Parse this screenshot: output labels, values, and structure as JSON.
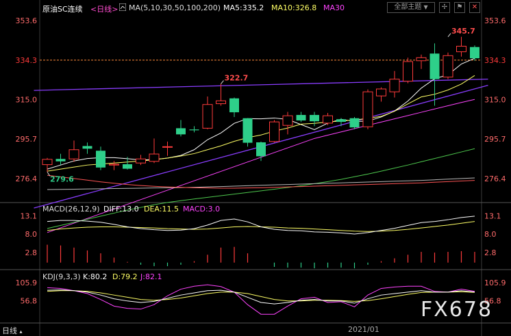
{
  "header": {
    "title": "原油SC连续",
    "period": "<日线>",
    "ma_label": "MA(5,10,30,50,100,200)",
    "ma5": "MA5:335.2",
    "ma10": "MA10:326.8",
    "ma30": "MA30",
    "all_themes": "全部主题",
    "indicator_icon": "bar-chart-icon"
  },
  "macd_header": {
    "label": "MACD(26,12,9)",
    "diff": "DIFF:13.0",
    "dea": "DEA:11.5",
    "macd": "MACD:3.0"
  },
  "kdj_header": {
    "label": "KDJ(9,3,3)",
    "k": "K:80.2",
    "d": "D:79.2",
    "j": "J:82.1"
  },
  "bottom": {
    "period": "日线",
    "date": "2021/01",
    "watermark": "FX678"
  },
  "colors": {
    "up": "#ff3b3b",
    "down": "#2ecf8a",
    "ma5": "#ffffff",
    "ma10": "#ffff66",
    "ma30": "#ff44ff",
    "ma50": "#4ec94e",
    "ma100": "#bbbbbb",
    "ma200": "#ff5555",
    "trend": "#8a3dff"
  },
  "chart_data": [
    {
      "type": "candlestick",
      "title": "原油SC连续 <日线>",
      "y_ticks": [
        "353.6",
        "334.3",
        "315.0",
        "295.7",
        "276.4"
      ],
      "ylim": [
        266.0,
        357.0
      ],
      "current_price": 334.3,
      "annotations": [
        {
          "label": "345.7",
          "value": 345.7,
          "index": 30
        },
        {
          "label": "322.7",
          "value": 322.7,
          "index": 13
        },
        {
          "label": "279.6",
          "value": 279.6,
          "index": 0
        }
      ],
      "candles": [
        {
          "o": 283.2,
          "c": 285.8,
          "h": 286.5,
          "l": 279.6
        },
        {
          "o": 286.0,
          "c": 284.8,
          "h": 288.5,
          "l": 283.0
        },
        {
          "o": 286.0,
          "c": 290.5,
          "h": 295.0,
          "l": 284.6
        },
        {
          "o": 292.3,
          "c": 291.0,
          "h": 294.0,
          "l": 288.5
        },
        {
          "o": 290.0,
          "c": 281.8,
          "h": 292.0,
          "l": 280.5
        },
        {
          "o": 283.0,
          "c": 283.4,
          "h": 285.0,
          "l": 280.5
        },
        {
          "o": 283.4,
          "c": 281.2,
          "h": 287.0,
          "l": 280.8
        },
        {
          "o": 284.0,
          "c": 286.0,
          "h": 288.0,
          "l": 283.0
        },
        {
          "o": 284.8,
          "c": 288.4,
          "h": 296.0,
          "l": 284.0
        },
        {
          "o": 292.0,
          "c": 292.0,
          "h": 294.5,
          "l": 287.5
        },
        {
          "o": 301.0,
          "c": 298.0,
          "h": 305.0,
          "l": 297.0
        },
        {
          "o": 300.4,
          "c": 300.0,
          "h": 302.0,
          "l": 299.0
        },
        {
          "o": 301.0,
          "c": 312.6,
          "h": 316.5,
          "l": 300.5
        },
        {
          "o": 313.0,
          "c": 314.4,
          "h": 322.7,
          "l": 312.0
        },
        {
          "o": 315.6,
          "c": 308.8,
          "h": 316.0,
          "l": 306.5
        },
        {
          "o": 305.9,
          "c": 293.9,
          "h": 306.0,
          "l": 292.0
        },
        {
          "o": 294.1,
          "c": 287.3,
          "h": 294.5,
          "l": 285.0
        },
        {
          "o": 294.5,
          "c": 304.1,
          "h": 305.0,
          "l": 294.0
        },
        {
          "o": 302.4,
          "c": 307.1,
          "h": 309.0,
          "l": 298.0
        },
        {
          "o": 307.5,
          "c": 304.8,
          "h": 309.0,
          "l": 304.0
        },
        {
          "o": 307.5,
          "c": 304.4,
          "h": 309.0,
          "l": 302.0
        },
        {
          "o": 303.5,
          "c": 307.1,
          "h": 308.5,
          "l": 302.5
        },
        {
          "o": 305.4,
          "c": 304.1,
          "h": 306.0,
          "l": 302.0
        },
        {
          "o": 305.9,
          "c": 301.4,
          "h": 306.5,
          "l": 300.5
        },
        {
          "o": 301.7,
          "c": 318.8,
          "h": 320.0,
          "l": 300.5
        },
        {
          "o": 316.8,
          "c": 320.2,
          "h": 321.0,
          "l": 314.0
        },
        {
          "o": 318.8,
          "c": 325.0,
          "h": 329.0,
          "l": 316.0
        },
        {
          "o": 324.0,
          "c": 333.6,
          "h": 335.5,
          "l": 323.0
        },
        {
          "o": 334.0,
          "c": 335.5,
          "h": 337.0,
          "l": 330.0
        },
        {
          "o": 337.5,
          "c": 325.0,
          "h": 342.5,
          "l": 312.0
        },
        {
          "o": 326.0,
          "c": 336.5,
          "h": 338.0,
          "l": 325.0
        },
        {
          "o": 338.4,
          "c": 341.1,
          "h": 345.7,
          "l": 336.0
        },
        {
          "o": 340.7,
          "c": 335.2,
          "h": 341.5,
          "l": 334.0
        }
      ],
      "ma": [
        {
          "name": "MA5",
          "values": [
            281,
            283,
            285,
            286.2,
            286.6,
            286.6,
            286.1,
            285.5,
            285.7,
            286.4,
            287.7,
            290.5,
            295.4,
            298.7,
            303.4,
            305.7,
            305.6,
            306.0,
            305.3,
            302.8,
            300.3,
            303.5,
            305.4,
            304.3,
            304.5,
            306.5,
            309.4,
            314.3,
            320.6,
            325.2,
            327.1,
            332.4,
            335.2
          ]
        },
        {
          "name": "MA10",
          "values": [
            280,
            281,
            282,
            283,
            283.5,
            284,
            284.5,
            285,
            285.6,
            286.4,
            287.4,
            288.6,
            290.5,
            292.4,
            294.6,
            296.4,
            297.7,
            299.6,
            301.1,
            303.0,
            303.4,
            304.0,
            304.6,
            305.0,
            305.8,
            306.8,
            309.3,
            312.9,
            316.3,
            317.6,
            319.7,
            322.6,
            326.8
          ]
        },
        {
          "name": "MA30",
          "values": [
            250,
            252.3,
            254.6,
            256.9,
            259.2,
            261.5,
            263.8,
            266.1,
            268.4,
            270.7,
            273,
            275.3,
            277.6,
            279.9,
            282.2,
            284.5,
            286.8,
            289.1,
            291.4,
            293.7,
            296,
            297.6,
            299.2,
            300.8,
            302.4,
            304,
            305.6,
            307.2,
            308.8,
            310.4,
            312,
            313.6,
            315.1
          ]
        },
        {
          "name": "MA50",
          "values": [
            252,
            253.5,
            255,
            256.5,
            258,
            259.5,
            261,
            262.3,
            263.6,
            264.7,
            265.6,
            266.4,
            267.2,
            268,
            268.8,
            269.6,
            270.4,
            271.2,
            272,
            272.9,
            273.9,
            274.9,
            276,
            277.3,
            278.6,
            280,
            281.5,
            283,
            284.6,
            286.2,
            287.8,
            289.4,
            291
          ]
        },
        {
          "name": "MA100",
          "values": [
            271,
            271.1,
            271.2,
            271.3,
            271.4,
            271.5,
            271.6,
            271.7,
            271.8,
            271.9,
            272,
            272.1,
            272.3,
            272.5,
            272.7,
            272.9,
            273.1,
            273.3,
            273.5,
            273.7,
            273.9,
            274.1,
            274.3,
            274.5,
            274.7,
            274.9,
            275.1,
            275.3,
            275.5,
            275.8,
            276.1,
            276.4,
            276.7
          ]
        },
        {
          "name": "MA200",
          "values": [
            278,
            277.2,
            276.4,
            275.6,
            274.8,
            274.1,
            273.5,
            273,
            272.6,
            272.3,
            272.1,
            271.9,
            271.8,
            271.7,
            271.7,
            271.8,
            271.9,
            272.1,
            272.3,
            272.5,
            272.7,
            272.9,
            273.1,
            273.3,
            273.5,
            273.7,
            273.9,
            274.1,
            274.3,
            274.6,
            274.9,
            275.2,
            275.5
          ]
        }
      ],
      "trendlines": [
        {
          "from": [
            -1,
            319.5
          ],
          "to": [
            33,
            325.0
          ]
        },
        {
          "from": [
            -1,
            262.0
          ],
          "to": [
            33,
            322.0
          ]
        }
      ]
    },
    {
      "type": "macd",
      "title": "MACD(26,12,9)",
      "y_ticks": [
        "13.1",
        "8.0",
        "2.8"
      ],
      "ylim": [
        -1.2,
        14.5
      ],
      "diff": [
        11.5,
        11.8,
        11.8,
        11.6,
        11.3,
        10.7,
        10.0,
        9.5,
        9.2,
        9.0,
        9.1,
        9.5,
        10.5,
        11.8,
        12.2,
        11.4,
        10.0,
        9.3,
        9.0,
        8.9,
        8.6,
        8.5,
        8.3,
        8.0,
        8.4,
        9.0,
        9.6,
        10.4,
        11.2,
        11.5,
        12.0,
        12.6,
        13.0
      ],
      "dea": [
        9.0,
        9.4,
        9.7,
        9.9,
        10.0,
        10.0,
        9.9,
        9.8,
        9.7,
        9.5,
        9.4,
        9.3,
        9.4,
        9.7,
        10.0,
        10.1,
        10.0,
        9.9,
        9.7,
        9.6,
        9.4,
        9.2,
        9.0,
        8.8,
        8.7,
        8.8,
        9.0,
        9.3,
        9.7,
        10.1,
        10.5,
        11.0,
        11.5
      ],
      "macd": [
        5.0,
        4.8,
        4.2,
        3.4,
        2.6,
        1.4,
        0.2,
        -0.6,
        -1.0,
        -1.0,
        -0.6,
        0.4,
        2.2,
        4.2,
        4.4,
        2.6,
        0.0,
        -1.2,
        -1.4,
        -1.4,
        -1.6,
        -1.4,
        -1.4,
        -1.6,
        -0.6,
        0.4,
        1.2,
        2.2,
        3.0,
        2.8,
        3.0,
        3.2,
        3.0
      ]
    },
    {
      "type": "kdj",
      "title": "KDJ(9,3,3)",
      "y_ticks": [
        "105.9",
        "56.8"
      ],
      "ylim": [
        0,
        115
      ],
      "k": [
        85,
        86,
        84,
        80,
        72,
        62,
        56,
        52,
        55,
        63,
        72,
        78,
        84,
        85,
        80,
        66,
        52,
        48,
        52,
        58,
        60,
        56,
        56,
        50,
        62,
        72,
        76,
        80,
        84,
        80,
        80,
        84,
        80.2
      ],
      "d": [
        82,
        84,
        84,
        82,
        78,
        72,
        66,
        60,
        58,
        60,
        64,
        70,
        76,
        80,
        80,
        76,
        68,
        60,
        56,
        56,
        58,
        58,
        57,
        55,
        57,
        62,
        68,
        74,
        79,
        80,
        80,
        81,
        79.2
      ],
      "j": [
        92,
        90,
        84,
        76,
        60,
        42,
        36,
        34,
        46,
        70,
        88,
        96,
        100,
        95,
        80,
        46,
        20,
        20,
        42,
        62,
        66,
        52,
        54,
        40,
        72,
        90,
        94,
        96,
        96,
        82,
        80,
        88,
        82.1
      ]
    }
  ]
}
